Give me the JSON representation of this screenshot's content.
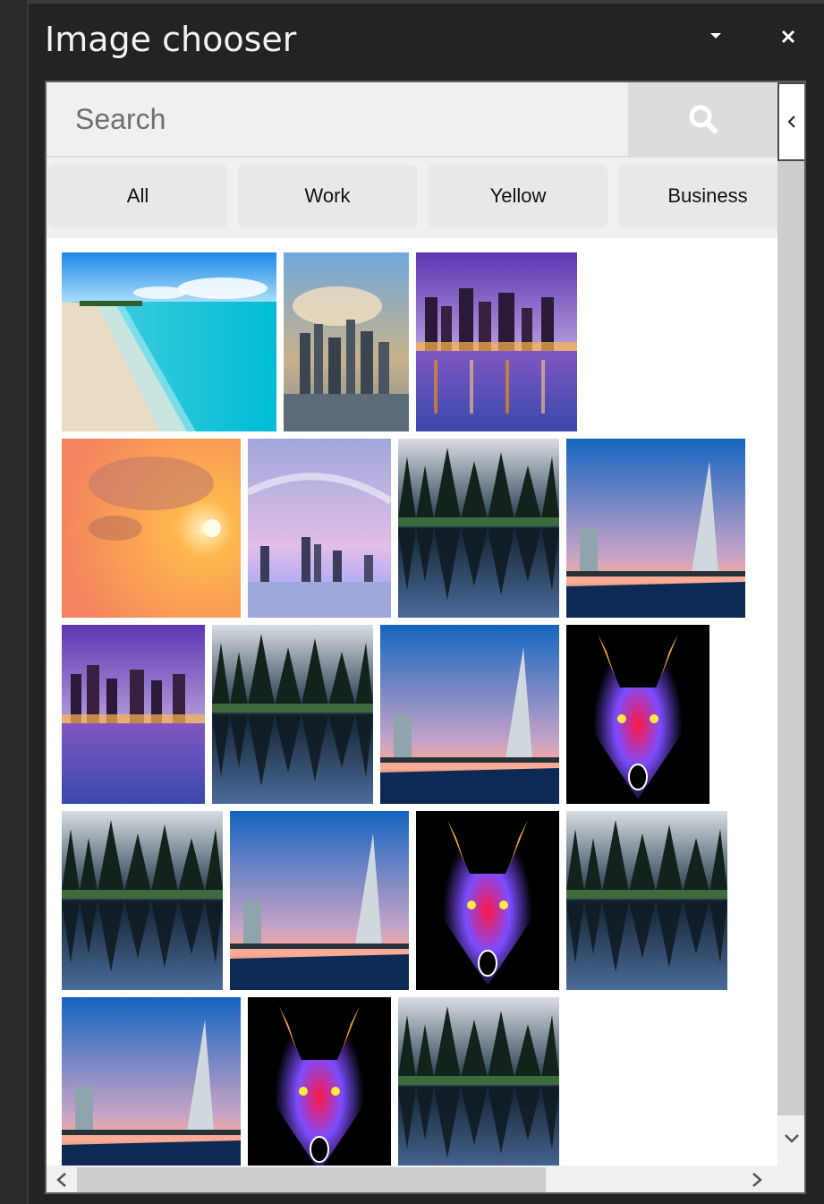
{
  "window": {
    "title": "Image chooser",
    "dropdown_icon": "caret-down-icon",
    "close_icon": "close-icon"
  },
  "search": {
    "placeholder": "Search",
    "value": "",
    "button_icon": "search-icon"
  },
  "collapse_icon": "chevron-left-icon",
  "filters": [
    {
      "label": "All"
    },
    {
      "label": "Work"
    },
    {
      "label": "Yellow"
    },
    {
      "label": "Business"
    }
  ],
  "images": [
    {
      "subject": "beach"
    },
    {
      "subject": "city-clouds"
    },
    {
      "subject": "city-night"
    },
    {
      "subject": "sunset"
    },
    {
      "subject": "city-pink-sky"
    },
    {
      "subject": "forest-lake"
    },
    {
      "subject": "burj-al-arab"
    },
    {
      "subject": "city-night"
    },
    {
      "subject": "forest-lake"
    },
    {
      "subject": "burj-al-arab"
    },
    {
      "subject": "neon-wolf"
    },
    {
      "subject": "forest-lake"
    },
    {
      "subject": "burj-al-arab"
    },
    {
      "subject": "neon-wolf"
    },
    {
      "subject": "forest-lake"
    },
    {
      "subject": "burj-al-arab"
    },
    {
      "subject": "neon-wolf"
    },
    {
      "subject": "forest-lake"
    }
  ],
  "scrollbars": {
    "up_icon": "chevron-down-icon",
    "left_icon": "chevron-left-icon",
    "right_icon": "chevron-right-icon"
  },
  "colors": {
    "window_bg": "#232323",
    "panel_bg": "#ffffff",
    "chip_bg": "#e8e8e8",
    "search_button_bg": "#dcdcdc"
  }
}
